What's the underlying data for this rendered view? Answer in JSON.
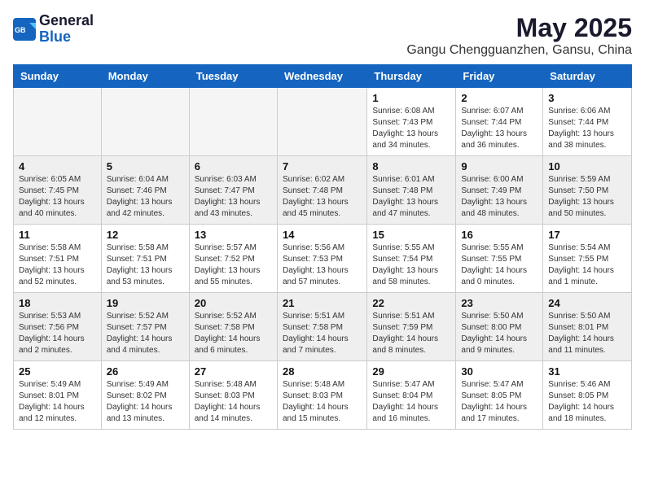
{
  "header": {
    "logo_general": "General",
    "logo_blue": "Blue",
    "month_title": "May 2025",
    "location": "Gangu Chengguanzhen, Gansu, China"
  },
  "weekdays": [
    "Sunday",
    "Monday",
    "Tuesday",
    "Wednesday",
    "Thursday",
    "Friday",
    "Saturday"
  ],
  "weeks": [
    [
      {
        "day": "",
        "info": ""
      },
      {
        "day": "",
        "info": ""
      },
      {
        "day": "",
        "info": ""
      },
      {
        "day": "",
        "info": ""
      },
      {
        "day": "1",
        "info": "Sunrise: 6:08 AM\nSunset: 7:43 PM\nDaylight: 13 hours\nand 34 minutes."
      },
      {
        "day": "2",
        "info": "Sunrise: 6:07 AM\nSunset: 7:44 PM\nDaylight: 13 hours\nand 36 minutes."
      },
      {
        "day": "3",
        "info": "Sunrise: 6:06 AM\nSunset: 7:44 PM\nDaylight: 13 hours\nand 38 minutes."
      }
    ],
    [
      {
        "day": "4",
        "info": "Sunrise: 6:05 AM\nSunset: 7:45 PM\nDaylight: 13 hours\nand 40 minutes."
      },
      {
        "day": "5",
        "info": "Sunrise: 6:04 AM\nSunset: 7:46 PM\nDaylight: 13 hours\nand 42 minutes."
      },
      {
        "day": "6",
        "info": "Sunrise: 6:03 AM\nSunset: 7:47 PM\nDaylight: 13 hours\nand 43 minutes."
      },
      {
        "day": "7",
        "info": "Sunrise: 6:02 AM\nSunset: 7:48 PM\nDaylight: 13 hours\nand 45 minutes."
      },
      {
        "day": "8",
        "info": "Sunrise: 6:01 AM\nSunset: 7:48 PM\nDaylight: 13 hours\nand 47 minutes."
      },
      {
        "day": "9",
        "info": "Sunrise: 6:00 AM\nSunset: 7:49 PM\nDaylight: 13 hours\nand 48 minutes."
      },
      {
        "day": "10",
        "info": "Sunrise: 5:59 AM\nSunset: 7:50 PM\nDaylight: 13 hours\nand 50 minutes."
      }
    ],
    [
      {
        "day": "11",
        "info": "Sunrise: 5:58 AM\nSunset: 7:51 PM\nDaylight: 13 hours\nand 52 minutes."
      },
      {
        "day": "12",
        "info": "Sunrise: 5:58 AM\nSunset: 7:51 PM\nDaylight: 13 hours\nand 53 minutes."
      },
      {
        "day": "13",
        "info": "Sunrise: 5:57 AM\nSunset: 7:52 PM\nDaylight: 13 hours\nand 55 minutes."
      },
      {
        "day": "14",
        "info": "Sunrise: 5:56 AM\nSunset: 7:53 PM\nDaylight: 13 hours\nand 57 minutes."
      },
      {
        "day": "15",
        "info": "Sunrise: 5:55 AM\nSunset: 7:54 PM\nDaylight: 13 hours\nand 58 minutes."
      },
      {
        "day": "16",
        "info": "Sunrise: 5:55 AM\nSunset: 7:55 PM\nDaylight: 14 hours\nand 0 minutes."
      },
      {
        "day": "17",
        "info": "Sunrise: 5:54 AM\nSunset: 7:55 PM\nDaylight: 14 hours\nand 1 minute."
      }
    ],
    [
      {
        "day": "18",
        "info": "Sunrise: 5:53 AM\nSunset: 7:56 PM\nDaylight: 14 hours\nand 2 minutes."
      },
      {
        "day": "19",
        "info": "Sunrise: 5:52 AM\nSunset: 7:57 PM\nDaylight: 14 hours\nand 4 minutes."
      },
      {
        "day": "20",
        "info": "Sunrise: 5:52 AM\nSunset: 7:58 PM\nDaylight: 14 hours\nand 6 minutes."
      },
      {
        "day": "21",
        "info": "Sunrise: 5:51 AM\nSunset: 7:58 PM\nDaylight: 14 hours\nand 7 minutes."
      },
      {
        "day": "22",
        "info": "Sunrise: 5:51 AM\nSunset: 7:59 PM\nDaylight: 14 hours\nand 8 minutes."
      },
      {
        "day": "23",
        "info": "Sunrise: 5:50 AM\nSunset: 8:00 PM\nDaylight: 14 hours\nand 9 minutes."
      },
      {
        "day": "24",
        "info": "Sunrise: 5:50 AM\nSunset: 8:01 PM\nDaylight: 14 hours\nand 11 minutes."
      }
    ],
    [
      {
        "day": "25",
        "info": "Sunrise: 5:49 AM\nSunset: 8:01 PM\nDaylight: 14 hours\nand 12 minutes."
      },
      {
        "day": "26",
        "info": "Sunrise: 5:49 AM\nSunset: 8:02 PM\nDaylight: 14 hours\nand 13 minutes."
      },
      {
        "day": "27",
        "info": "Sunrise: 5:48 AM\nSunset: 8:03 PM\nDaylight: 14 hours\nand 14 minutes."
      },
      {
        "day": "28",
        "info": "Sunrise: 5:48 AM\nSunset: 8:03 PM\nDaylight: 14 hours\nand 15 minutes."
      },
      {
        "day": "29",
        "info": "Sunrise: 5:47 AM\nSunset: 8:04 PM\nDaylight: 14 hours\nand 16 minutes."
      },
      {
        "day": "30",
        "info": "Sunrise: 5:47 AM\nSunset: 8:05 PM\nDaylight: 14 hours\nand 17 minutes."
      },
      {
        "day": "31",
        "info": "Sunrise: 5:46 AM\nSunset: 8:05 PM\nDaylight: 14 hours\nand 18 minutes."
      }
    ]
  ]
}
